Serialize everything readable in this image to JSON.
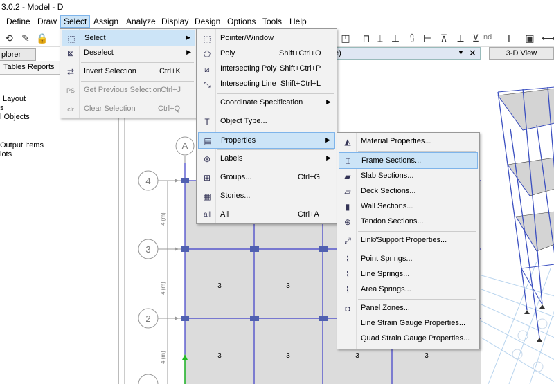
{
  "title": "3.0.2 - Model - D",
  "menubar": [
    "Define",
    "Draw",
    "Select",
    "Assign",
    "Analyze",
    "Display",
    "Design",
    "Options",
    "Tools",
    "Help"
  ],
  "toolbar": {
    "nd_label": "nd"
  },
  "explorer": {
    "tab": "plorer",
    "subtabs": [
      "Tables",
      "Reports"
    ],
    "tree": [
      "Layout",
      "s",
      "l Objects",
      "Output Items",
      "lots"
    ]
  },
  "plan": {
    "tab_label": "e)",
    "grid_labels": {
      "col_a": "A",
      "row_4": "4",
      "row_3": "3",
      "row_2": "2"
    },
    "dim_label": "4 (m)",
    "area_labels": [
      "3",
      "3",
      "3",
      "3",
      "3",
      "3",
      "3"
    ]
  },
  "view3d": {
    "tab": "3-D View"
  },
  "select_menu": [
    {
      "label": "Select",
      "shortcut": "",
      "submenu": true,
      "icon": "pointer-select-icon"
    },
    {
      "label": "Deselect",
      "shortcut": "",
      "submenu": true,
      "icon": "deselect-icon"
    },
    {
      "label": "Invert Selection",
      "shortcut": "Ctrl+K",
      "icon": "invert-icon"
    },
    {
      "label": "Get Previous Selection",
      "shortcut": "Ctrl+J",
      "icon": "previous-selection-icon",
      "disabled": true
    },
    {
      "label": "Clear Selection",
      "shortcut": "Ctrl+Q",
      "icon": "clear-selection-icon",
      "disabled": true
    }
  ],
  "select_submenu": [
    {
      "label": "Pointer/Window",
      "shortcut": "",
      "icon": "pointer-window-icon"
    },
    {
      "label": "Poly",
      "shortcut": "Shift+Ctrl+O",
      "icon": "poly-icon"
    },
    {
      "label": "Intersecting Poly",
      "shortcut": "Shift+Ctrl+P",
      "icon": "intersecting-poly-icon"
    },
    {
      "label": "Intersecting Line",
      "shortcut": "Shift+Ctrl+L",
      "icon": "intersecting-line-icon"
    },
    {
      "label": "Coordinate Specification",
      "shortcut": "",
      "submenu": true,
      "icon": "coordinate-icon"
    },
    {
      "label": "Object Type...",
      "shortcut": "",
      "icon": "object-type-icon"
    },
    {
      "label": "Properties",
      "shortcut": "",
      "submenu": true,
      "icon": "properties-icon"
    },
    {
      "label": "Labels",
      "shortcut": "",
      "submenu": true,
      "icon": "labels-icon"
    },
    {
      "label": "Groups...",
      "shortcut": "Ctrl+G",
      "icon": "groups-icon"
    },
    {
      "label": "Stories...",
      "shortcut": "",
      "icon": "stories-icon"
    },
    {
      "label": "All",
      "shortcut": "Ctrl+A",
      "icon": "all-icon"
    }
  ],
  "properties_submenu": [
    {
      "label": "Material Properties...",
      "icon": "material-icon"
    },
    {
      "label": "Frame Sections...",
      "icon": "frame-section-icon"
    },
    {
      "label": "Slab Sections...",
      "icon": "slab-section-icon"
    },
    {
      "label": "Deck Sections...",
      "icon": "deck-section-icon"
    },
    {
      "label": "Wall Sections...",
      "icon": "wall-section-icon"
    },
    {
      "label": "Tendon Sections...",
      "icon": "tendon-section-icon"
    },
    {
      "label": "Link/Support Properties...",
      "icon": "link-support-icon"
    },
    {
      "label": "Point Springs...",
      "icon": "point-spring-icon"
    },
    {
      "label": "Line Springs...",
      "icon": "line-spring-icon"
    },
    {
      "label": "Area Springs...",
      "icon": "area-spring-icon"
    },
    {
      "label": "Panel Zones...",
      "icon": "panel-zone-icon"
    },
    {
      "label": "Line Strain Gauge Properties...",
      "icon": "line-strain-gauge-icon"
    },
    {
      "label": "Quad Strain Gauge Properties...",
      "icon": "quad-strain-gauge-icon"
    }
  ]
}
